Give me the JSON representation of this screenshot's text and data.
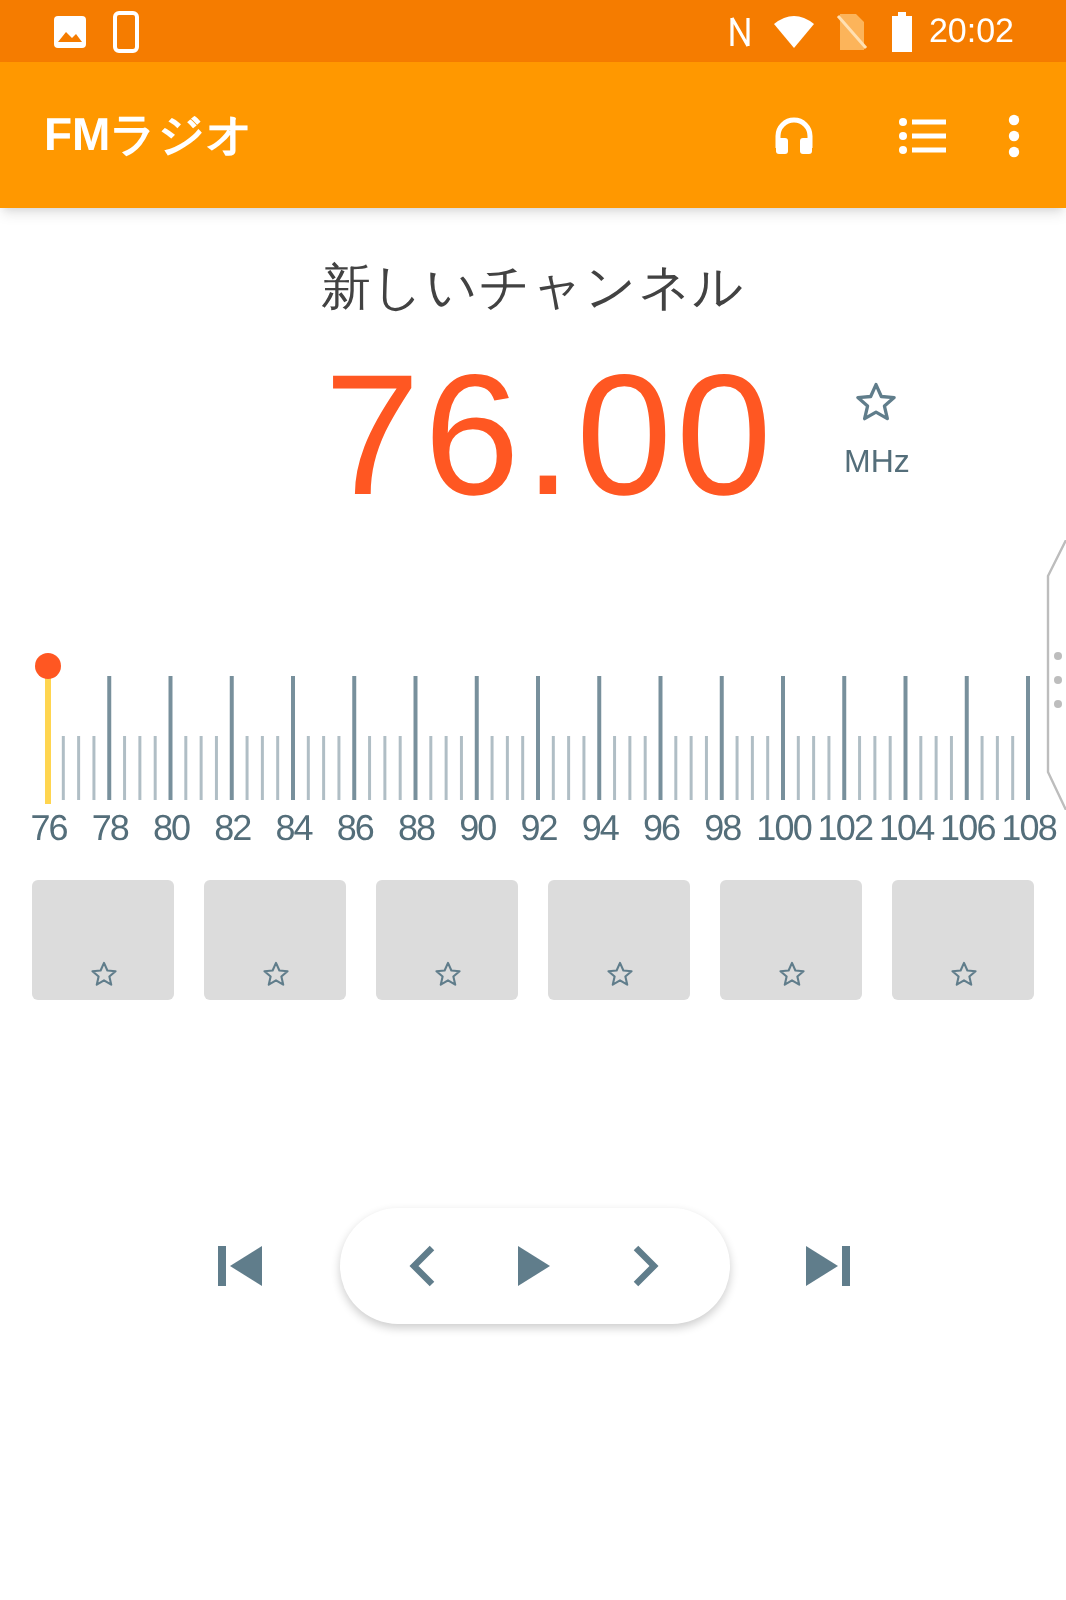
{
  "status_bar": {
    "time": "20:02"
  },
  "app_bar": {
    "title": "FMラジオ"
  },
  "station": {
    "name": "新しいチャンネル",
    "frequency": "76.00",
    "unit": "MHz",
    "favorite": false
  },
  "tuner": {
    "labels": [
      "76",
      "78",
      "80",
      "82",
      "84",
      "86",
      "88",
      "90",
      "92",
      "94",
      "96",
      "98",
      "100",
      "102",
      "104",
      "106",
      "108"
    ]
  },
  "presets": [
    {
      "favorite": false
    },
    {
      "favorite": false
    },
    {
      "favorite": false
    },
    {
      "favorite": false
    },
    {
      "favorite": false
    },
    {
      "favorite": false
    }
  ]
}
